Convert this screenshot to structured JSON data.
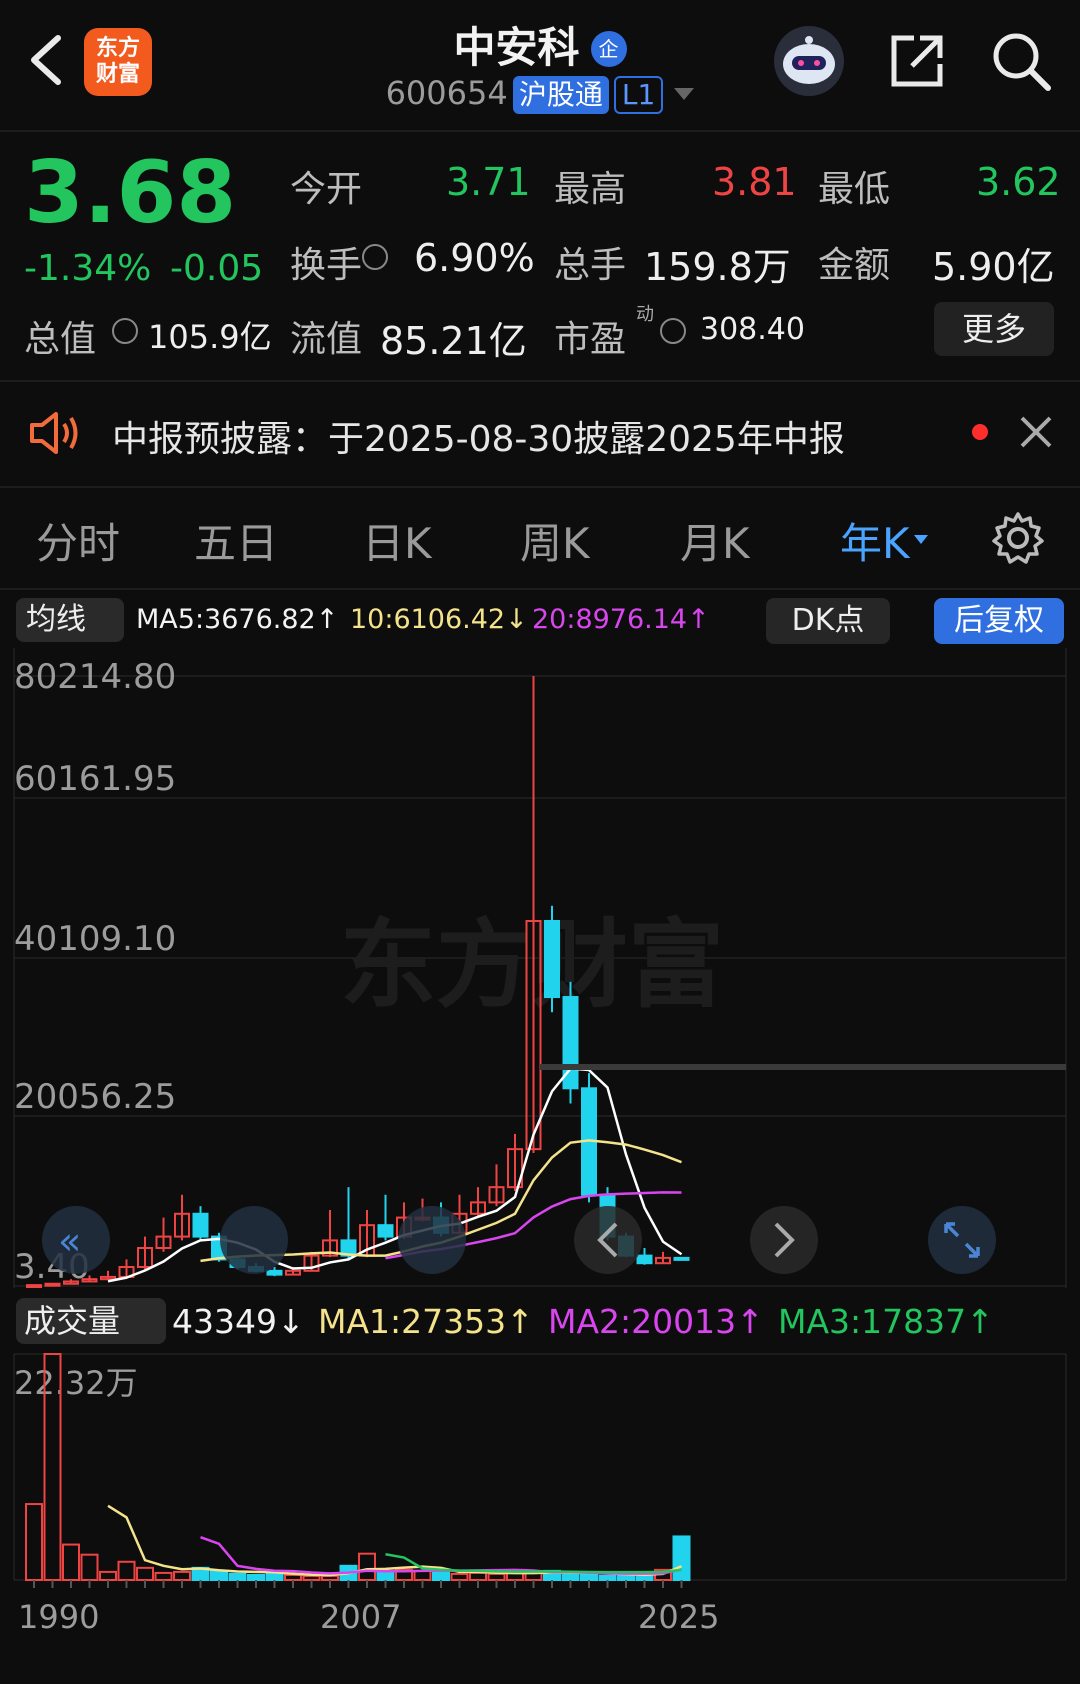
{
  "header": {
    "app_logo": "东方\n财富",
    "stock_name": "中安科",
    "enterprise_badge": "企",
    "stock_code": "600654",
    "exchange_badge": "沪股通",
    "level_badge": "L1"
  },
  "quote": {
    "price": "3.68",
    "change_pct": "-1.34%",
    "change_abs": "-0.05",
    "fields": {
      "open_label": "今开",
      "open_value": "3.71",
      "high_label": "最高",
      "high_value": "3.81",
      "low_label": "最低",
      "low_value": "3.62",
      "turnover_label": "换手",
      "turnover_value": "6.90%",
      "volume_label": "总手",
      "volume_value": "159.8万",
      "amount_label": "金额",
      "amount_value": "5.90亿",
      "mcap_label": "总值",
      "mcap_value": "105.9亿",
      "float_label": "流值",
      "float_value": "85.21亿",
      "pe_label": "市盈",
      "pe_super": "动",
      "pe_value": "308.40",
      "more_button": "更多"
    }
  },
  "notice": {
    "text": "中报预披露：于2025-08-30披露2025年中报"
  },
  "tabs": [
    {
      "label": "分时",
      "active": false
    },
    {
      "label": "五日",
      "active": false
    },
    {
      "label": "日K",
      "active": false
    },
    {
      "label": "周K",
      "active": false
    },
    {
      "label": "月K",
      "active": false
    },
    {
      "label": "年K",
      "active": true
    }
  ],
  "ma_bar": {
    "selector": "均线",
    "ma5": "MA5:3676.82↑",
    "ma10": "10:6106.42↓",
    "ma20": "20:8976.14↑",
    "dk_button": "DK点",
    "adjust_button": "后复权"
  },
  "price_axis": [
    "80214.80",
    "60161.95",
    "40109.10",
    "20056.25",
    "3.40"
  ],
  "watermark": "东方财富",
  "vol_bar": {
    "selector": "成交量",
    "current": "43349↓",
    "ma1": "MA1:27353↑",
    "ma2": "MA2:20013↑",
    "ma3": "MA3:17837↑"
  },
  "vol_axis_top": "22.32万",
  "x_axis": [
    "1990",
    "2007",
    "2025"
  ],
  "colors": {
    "up": "#ef4444",
    "down": "#22d3ee",
    "green": "#22c55e",
    "ma5": "#ffffff",
    "ma10": "#f4e38b",
    "ma20": "#d946ef",
    "ma3": "#22c55e",
    "accent": "#4aa3ff"
  },
  "chart_data": {
    "type": "candlestick",
    "title": "中安科 年K",
    "x": [
      "1990",
      "1991",
      "1992",
      "1993",
      "1994",
      "1995",
      "1996",
      "1997",
      "1998",
      "1999",
      "2000",
      "2001",
      "2002",
      "2003",
      "2004",
      "2005",
      "2006",
      "2007",
      "2008",
      "2009",
      "2010",
      "2011",
      "2012",
      "2013",
      "2014",
      "2015",
      "2016",
      "2017",
      "2018",
      "2019",
      "2020",
      "2021",
      "2022",
      "2023",
      "2024",
      "2025"
    ],
    "open": [
      100,
      120,
      300,
      600,
      900,
      1200,
      2500,
      5000,
      6500,
      9500,
      6500,
      3500,
      2500,
      2000,
      1500,
      2000,
      4000,
      6000,
      4000,
      8000,
      6500,
      9000,
      9000,
      7000,
      9500,
      11000,
      13000,
      18000,
      48000,
      38000,
      26000,
      12000,
      6500,
      4000,
      3000,
      3700
    ],
    "close": [
      120,
      300,
      600,
      900,
      1200,
      2500,
      5000,
      6500,
      9500,
      6500,
      3500,
      2500,
      2000,
      1500,
      2000,
      4000,
      6000,
      4000,
      8000,
      6500,
      9000,
      9000,
      7000,
      9500,
      11000,
      13000,
      18000,
      48000,
      38000,
      26000,
      12000,
      6500,
      4000,
      3000,
      3700,
      3680
    ],
    "high": [
      150,
      400,
      900,
      1400,
      2000,
      3500,
      6500,
      9000,
      12000,
      10500,
      7000,
      4000,
      3000,
      2500,
      2500,
      4500,
      10000,
      13000,
      10000,
      12000,
      11000,
      11500,
      11000,
      12000,
      13000,
      16000,
      20000,
      80214.8,
      50000,
      40000,
      28000,
      13000,
      7000,
      5000,
      4500,
      3810
    ],
    "low": [
      3.4,
      100,
      250,
      500,
      800,
      1100,
      2200,
      4500,
      6000,
      6000,
      3200,
      2200,
      1800,
      1300,
      1400,
      1900,
      3800,
      3500,
      3800,
      6000,
      6200,
      8500,
      6500,
      6800,
      9000,
      10500,
      12500,
      17500,
      36000,
      24000,
      11000,
      6000,
      3800,
      2800,
      2900,
      3620
    ],
    "volume_wan": [
      7.5,
      22.32,
      3.5,
      2.5,
      0.8,
      1.8,
      1.2,
      0.7,
      0.8,
      1.2,
      0.9,
      0.6,
      0.5,
      0.6,
      0.5,
      0.4,
      0.4,
      1.4,
      2.6,
      0.7,
      1.0,
      0.9,
      0.8,
      0.6,
      0.7,
      0.6,
      0.7,
      0.8,
      0.9,
      0.6,
      0.5,
      0.4,
      0.5,
      0.6,
      1.0,
      4.3
    ],
    "ylim": [
      3.4,
      80214.8
    ],
    "ytick_labels": [
      "80214.80",
      "60161.95",
      "40109.10",
      "20056.25",
      "3.40"
    ],
    "xtick_labels": [
      "1990",
      "2007",
      "2025"
    ],
    "series": [
      {
        "name": "MA5",
        "value_label": "3676.82"
      },
      {
        "name": "MA10",
        "value_label": "6106.42"
      },
      {
        "name": "MA20",
        "value_label": "8976.14"
      }
    ]
  }
}
